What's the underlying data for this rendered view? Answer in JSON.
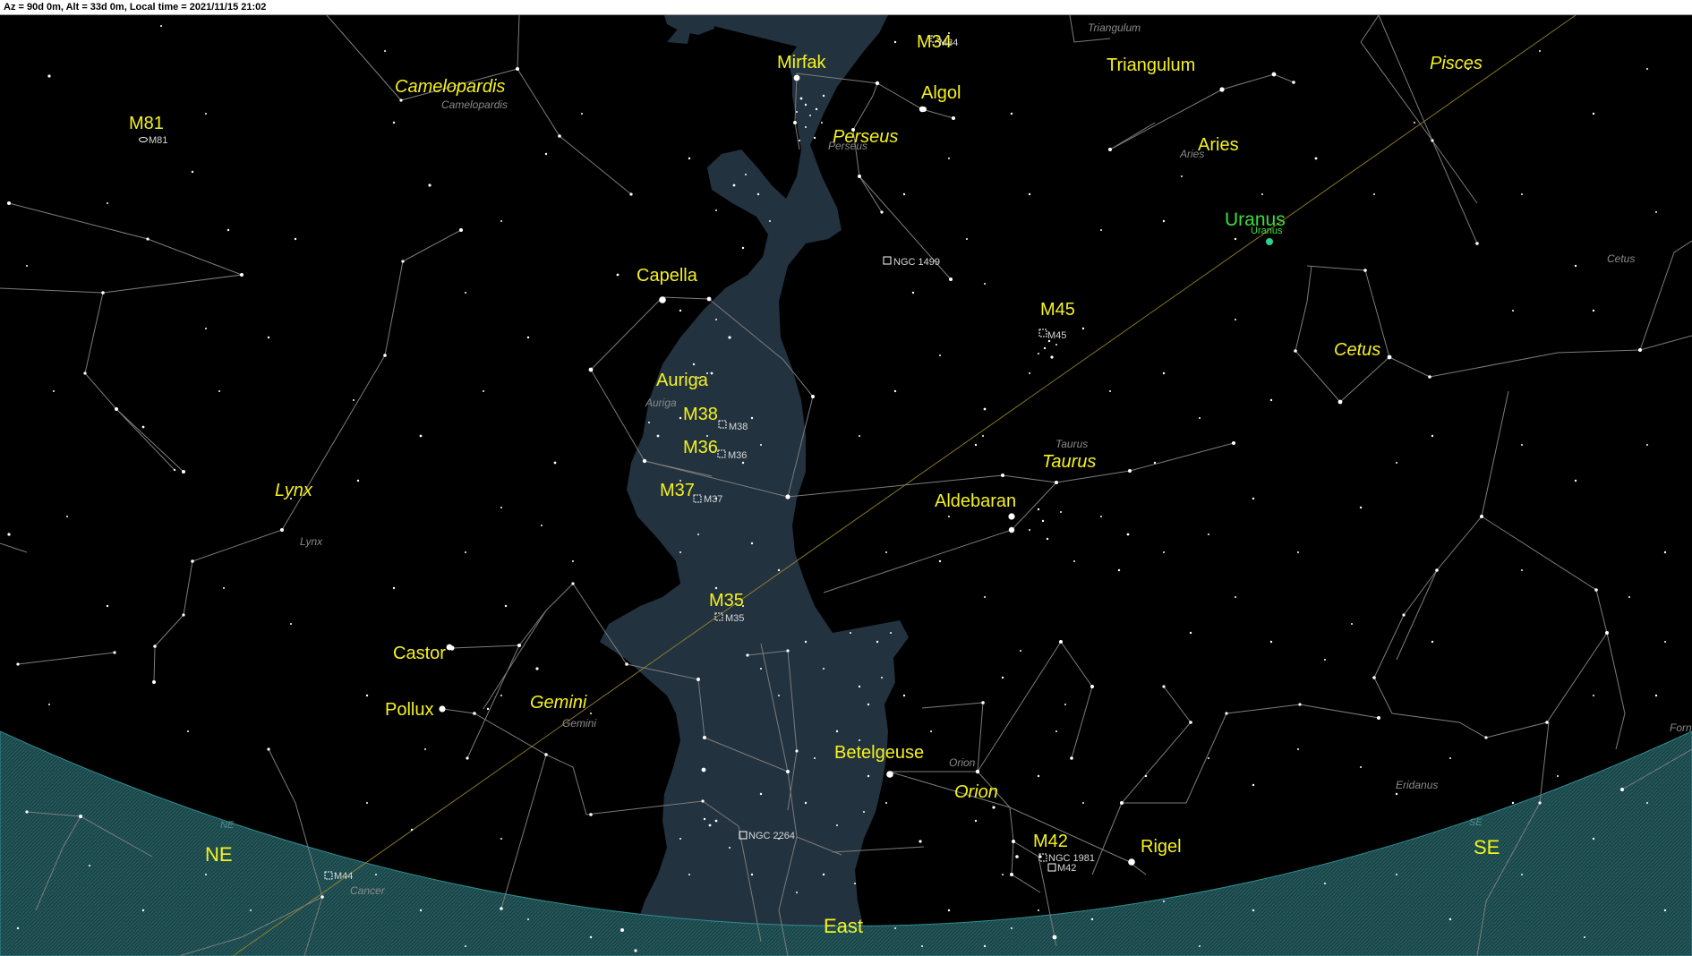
{
  "status_bar": {
    "text": "Az = 90d 0m, Alt = 33d 0m, Local time = 2021/11/15 21:02"
  },
  "colors": {
    "sky": "#000000",
    "milky_way": "#22323f",
    "horizon": "#1d4d50",
    "label": "#f5f21d",
    "planet": "#3adf3a",
    "constellation_line": "#7c7c7c",
    "ecliptic": "#a08a2a"
  },
  "stars_named": {
    "mirfak": "Mirfak",
    "algol": "Algol",
    "capella": "Capella",
    "aldebaran": "Aldebaran",
    "castor": "Castor",
    "pollux": "Pollux",
    "betelgeuse": "Betelgeuse",
    "rigel": "Rigel"
  },
  "constellations": {
    "camelopardis": "Camelopardis",
    "camelopardis_small": "Camelopardis",
    "perseus": "Perseus",
    "perseus_small": "Perseus",
    "triangulum": "Triangulum",
    "triangulum_small": "Triangulum",
    "pisces": "Pisces",
    "aries": "Aries",
    "aries_small": "Aries",
    "cetus": "Cetus",
    "cetus_small": "Cetus",
    "auriga": "Auriga",
    "auriga_small": "Auriga",
    "taurus": "Taurus",
    "taurus_small": "Taurus",
    "lynx": "Lynx",
    "lynx_small": "Lynx",
    "gemini": "Gemini",
    "gemini_small": "Gemini",
    "orion": "Orion",
    "orion_small": "Orion",
    "eridanus_small": "Eridanus",
    "cancer_small": "Cancer",
    "fornax_small": "Forn"
  },
  "deep_sky": {
    "m81": "M81",
    "m81_small": "M81",
    "m34": "M34",
    "m34_small": "M34",
    "m45": "M45",
    "m45_small": "M45",
    "m38": "M38",
    "m38_small": "M38",
    "m36": "M36",
    "m36_small": "M36",
    "m37": "M37",
    "m37_small": "M37",
    "m35": "M35",
    "m35_small": "M35",
    "m42": "M42",
    "m42_small": "M42",
    "m44_small": "M44",
    "ngc1499": "NGC 1499",
    "ngc2264": "NGC 2264",
    "ngc1981": "NGC 1981"
  },
  "planets": {
    "uranus": "Uranus",
    "uranus_small": "Uranus"
  },
  "directions": {
    "ne": "NE",
    "ne_small": "NE",
    "east": "East",
    "se": "SE",
    "se_small": "SE"
  }
}
